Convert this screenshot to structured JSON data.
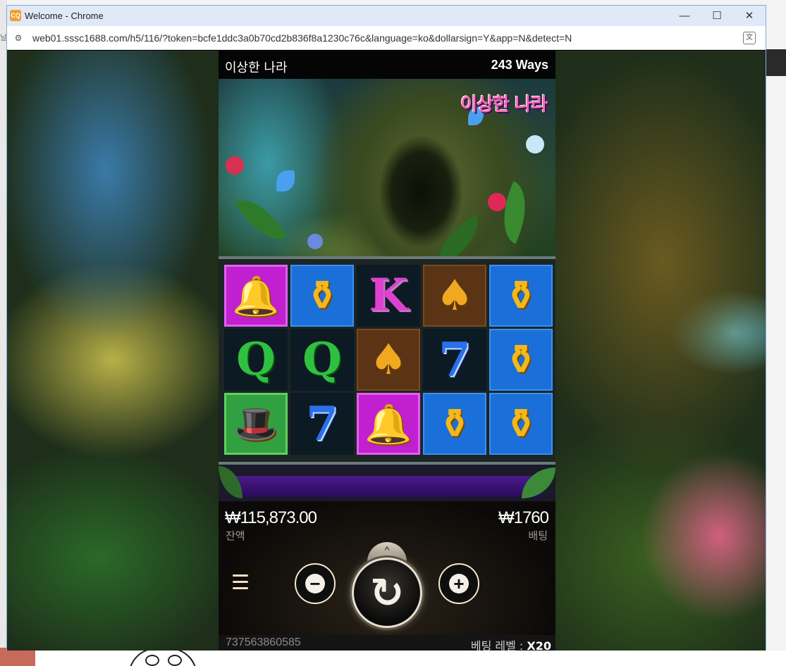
{
  "browser": {
    "window_title": "Welcome - Chrome",
    "app_icon_text": "CQ",
    "url": "web01.sssc1688.com/h5/116/?token=bcfe1ddc3a0b70cd2b836f8a1230c76c&language=ko&dollarsign=Y&app=N&detect=N",
    "controls": {
      "minimize": "—",
      "maximize": "☐",
      "close": "✕"
    }
  },
  "desktop": {
    "fragment_text": "날"
  },
  "game": {
    "title": "이상한 나라",
    "ways": "243 Ways",
    "logo_text": "이상한 나라",
    "reels": [
      [
        {
          "symbol": "bell",
          "glyph": "🔔",
          "bg": "magenta"
        },
        {
          "symbol": "Q",
          "glyph": "Q",
          "bg": "dark"
        },
        {
          "symbol": "hat",
          "glyph": "🎩",
          "bg": "green"
        }
      ],
      [
        {
          "symbol": "vase",
          "glyph": "⚱",
          "bg": "blue"
        },
        {
          "symbol": "Q",
          "glyph": "Q",
          "bg": "dark"
        },
        {
          "symbol": "seven",
          "glyph": "7",
          "bg": "dark"
        }
      ],
      [
        {
          "symbol": "K",
          "glyph": "K",
          "bg": "dark"
        },
        {
          "symbol": "spade",
          "glyph": "♠",
          "bg": "brown"
        },
        {
          "symbol": "bell",
          "glyph": "🔔",
          "bg": "magenta"
        }
      ],
      [
        {
          "symbol": "spade",
          "glyph": "♠",
          "bg": "brown"
        },
        {
          "symbol": "seven",
          "glyph": "7",
          "bg": "dark"
        },
        {
          "symbol": "vase",
          "glyph": "⚱",
          "bg": "blue"
        }
      ],
      [
        {
          "symbol": "vase",
          "glyph": "⚱",
          "bg": "blue"
        },
        {
          "symbol": "vase",
          "glyph": "⚱",
          "bg": "blue"
        },
        {
          "symbol": "vase",
          "glyph": "⚱",
          "bg": "blue"
        }
      ]
    ],
    "balance": "₩115,873.00",
    "balance_label": "잔액",
    "bet": "₩1760",
    "bet_label": "배팅",
    "round_id": "737563860585",
    "bet_level_label": "베팅 레벨 :",
    "bet_level_value": "X20",
    "icons": {
      "menu": "menu-icon",
      "minus": "−",
      "plus": "+",
      "spin": "↻",
      "expand": "^"
    }
  }
}
